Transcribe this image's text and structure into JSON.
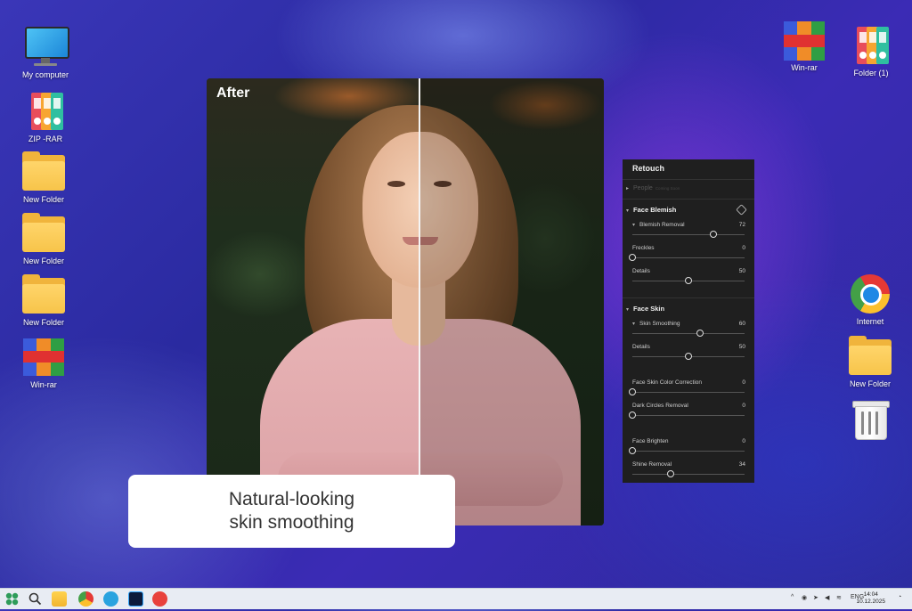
{
  "desktop_left": [
    {
      "label": "My computer",
      "icon": "monitor-icon"
    },
    {
      "label": "ZIP -RAR",
      "icon": "binders-icon"
    },
    {
      "label": "New Folder",
      "icon": "folder-icon"
    },
    {
      "label": "New Folder",
      "icon": "folder-icon"
    },
    {
      "label": "New Folder",
      "icon": "folder-icon"
    },
    {
      "label": "Win-rar",
      "icon": "winrar-icon"
    }
  ],
  "desktop_right": [
    {
      "label": "Win-rar",
      "icon": "winrar-icon"
    },
    {
      "label": "Folder (1)",
      "icon": "binders-icon"
    },
    {
      "label": "Internet",
      "icon": "chrome-icon"
    },
    {
      "label": "New Folder",
      "icon": "folder-icon"
    },
    {
      "label": "",
      "icon": "recycle-bin-icon"
    }
  ],
  "photo": {
    "after_label": "After"
  },
  "caption": {
    "line1": "Natural-looking",
    "line2": "skin smoothing"
  },
  "panel": {
    "title": "Retouch",
    "people": "People",
    "people_note": "Coming Soon",
    "sections": [
      {
        "name": "Face Blemish",
        "sliders": [
          {
            "label": "Blemish Removal",
            "value": "72",
            "level": 72
          },
          {
            "label": "Freckles",
            "value": "0",
            "level": 0
          },
          {
            "label": "Details",
            "value": "50",
            "level": 50
          }
        ]
      },
      {
        "name": "Face Skin",
        "sliders": [
          {
            "label": "Skin Smoothing",
            "value": "60",
            "level": 60
          },
          {
            "label": "Details",
            "value": "50",
            "level": 50
          },
          {
            "label": "Face Skin Color Correction",
            "value": "0",
            "level": 0
          },
          {
            "label": "Dark Circles Removal",
            "value": "0",
            "level": 0
          },
          {
            "label": "Face Brighten",
            "value": "0",
            "level": 0
          },
          {
            "label": "Shine Removal",
            "value": "34",
            "level": 34
          }
        ]
      }
    ]
  },
  "taskbar": {
    "lang": "ENG",
    "time": "14:04",
    "date": "10.12.2025"
  },
  "colors": {
    "panel_bg": "#1f1f1f",
    "caption_bg": "#ffffff",
    "taskbar_bg": "#e8ecf3"
  }
}
